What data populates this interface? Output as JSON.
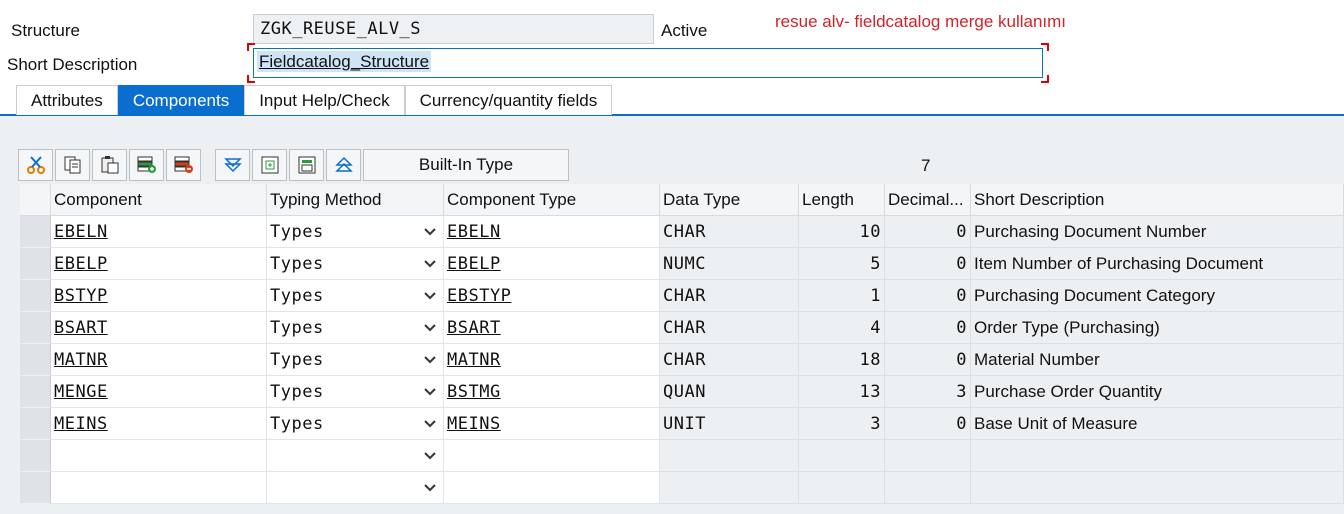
{
  "header": {
    "structure_label": "Structure",
    "structure_value": "ZGK_REUSE_ALV_S",
    "status": "Active",
    "short_desc_label": "Short Description",
    "short_desc_value": "Fieldcatalog_Structure",
    "annotation": "resue alv- fieldcatalog merge kullanımı"
  },
  "tabs": [
    {
      "label": "Attributes",
      "active": false
    },
    {
      "label": "Components",
      "active": true
    },
    {
      "label": "Input Help/Check",
      "active": false
    },
    {
      "label": "Currency/quantity fields",
      "active": false
    }
  ],
  "toolbar": {
    "icons": [
      "cut-icon",
      "copy-icon",
      "paste-icon",
      "insert-row-icon",
      "delete-row-icon",
      "filter-down-icon",
      "add-include-icon",
      "expand-include-icon",
      "move-up-icon"
    ],
    "builtin_label": "Built-In Type",
    "row_count": "7"
  },
  "columns": [
    "Component",
    "Typing Method",
    "Component Type",
    "Data Type",
    "Length",
    "Decimal...",
    "Short Description"
  ],
  "rows": [
    {
      "component": "EBELN",
      "typing": "Types",
      "comptype": "EBELN",
      "datatype": "CHAR",
      "length": "10",
      "decimal": "0",
      "desc": "Purchasing Document Number"
    },
    {
      "component": "EBELP",
      "typing": "Types",
      "comptype": "EBELP",
      "datatype": "NUMC",
      "length": "5",
      "decimal": "0",
      "desc": "Item Number of Purchasing Document"
    },
    {
      "component": "BSTYP",
      "typing": "Types",
      "comptype": "EBSTYP",
      "datatype": "CHAR",
      "length": "1",
      "decimal": "0",
      "desc": "Purchasing Document Category"
    },
    {
      "component": "BSART",
      "typing": "Types",
      "comptype": "BSART",
      "datatype": "CHAR",
      "length": "4",
      "decimal": "0",
      "desc": "Order Type (Purchasing)"
    },
    {
      "component": "MATNR",
      "typing": "Types",
      "comptype": "MATNR",
      "datatype": "CHAR",
      "length": "18",
      "decimal": "0",
      "desc": "Material Number"
    },
    {
      "component": "MENGE",
      "typing": "Types",
      "comptype": "BSTMG",
      "datatype": "QUAN",
      "length": "13",
      "decimal": "3",
      "desc": "Purchase Order Quantity"
    },
    {
      "component": "MEINS",
      "typing": "Types",
      "comptype": "MEINS",
      "datatype": "UNIT",
      "length": "3",
      "decimal": "0",
      "desc": "Base Unit of Measure"
    },
    {
      "component": "",
      "typing": "",
      "comptype": "",
      "datatype": "",
      "length": "",
      "decimal": "",
      "desc": ""
    },
    {
      "component": "",
      "typing": "",
      "comptype": "",
      "datatype": "",
      "length": "",
      "decimal": "",
      "desc": ""
    }
  ],
  "colors": {
    "accent": "#0a6ed1",
    "annotation": "#d0242a",
    "panel": "#edf0f2"
  }
}
